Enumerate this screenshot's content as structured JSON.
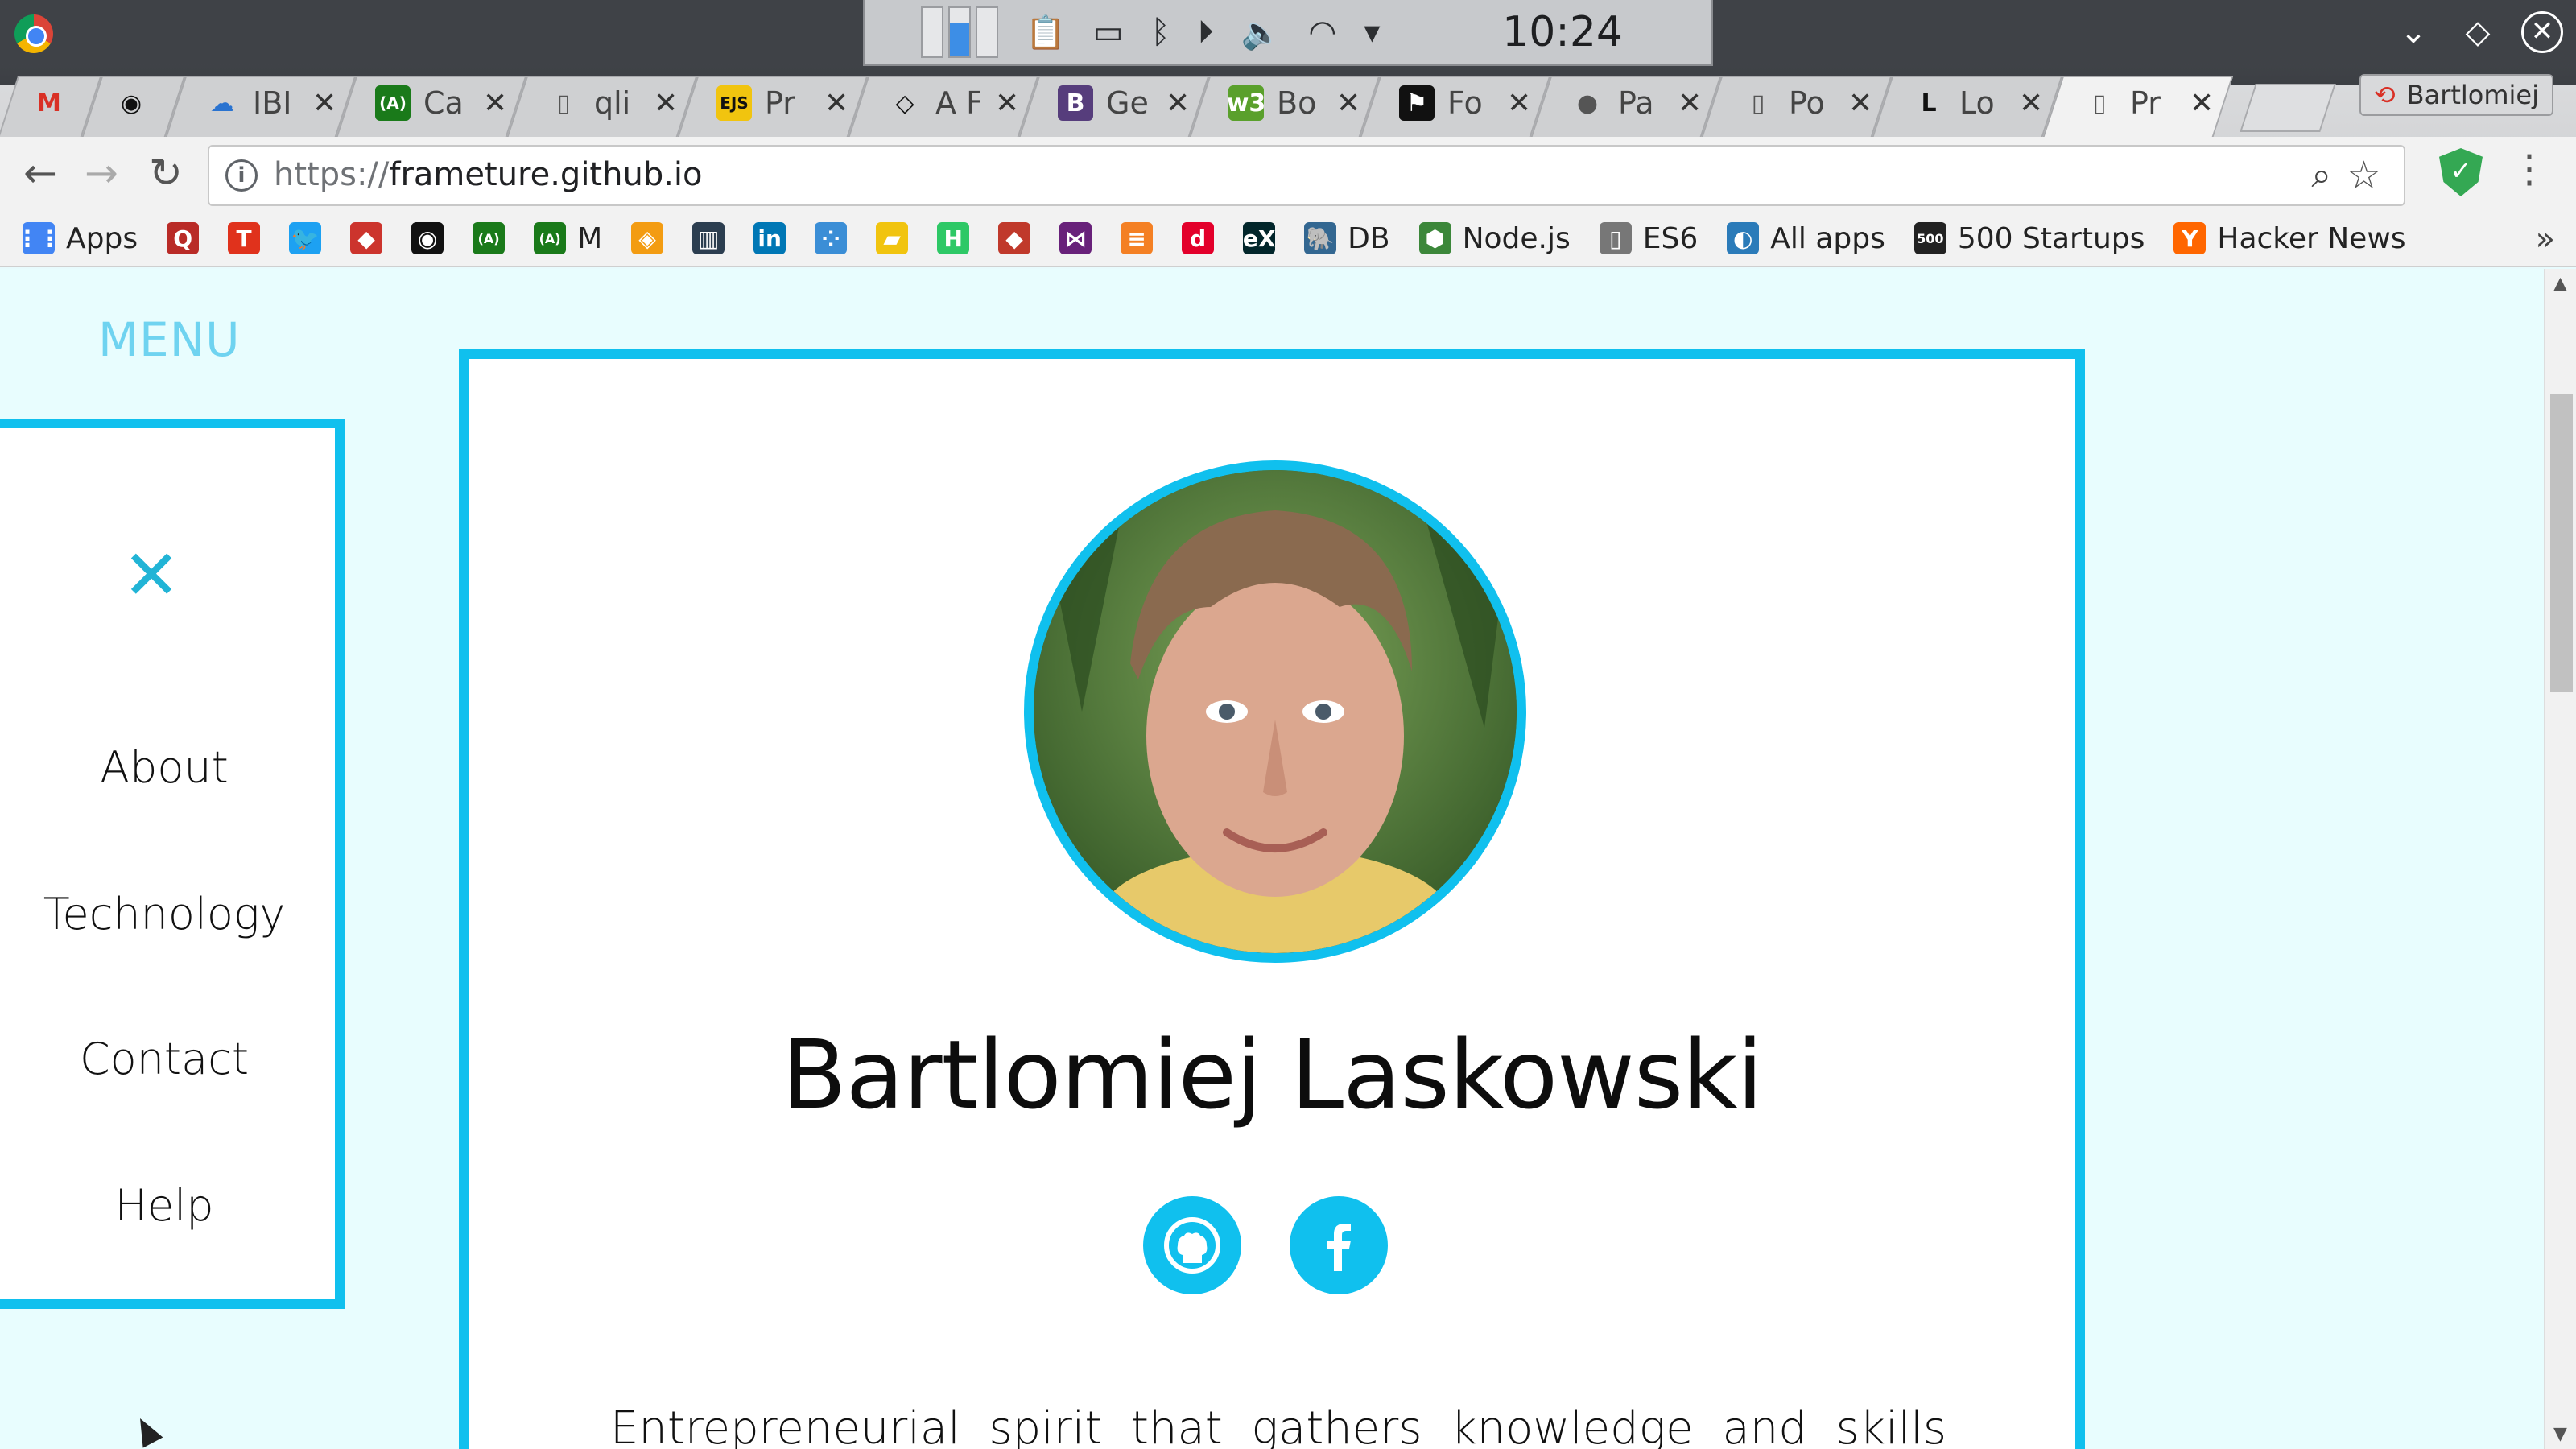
{
  "system_tray": {
    "clock": "10:24"
  },
  "tabs": [
    {
      "icon": "gmail-icon",
      "label": "",
      "fav": "M",
      "fav_color": "#d93025",
      "fav_bg": "transparent"
    },
    {
      "icon": "github-icon",
      "label": "",
      "fav": "◉",
      "fav_color": "#111",
      "fav_bg": "transparent"
    },
    {
      "icon": "ibm-cloud-icon",
      "label": "IBI",
      "fav": "☁",
      "fav_color": "#2a73d0",
      "fav_bg": "transparent"
    },
    {
      "icon": "freecodecamp-icon",
      "label": "Ca",
      "fav": "(A)",
      "fav_color": "#fff",
      "fav_bg": "#1a7a1a"
    },
    {
      "icon": "document-icon",
      "label": "qli",
      "fav": "▯",
      "fav_color": "#555",
      "fav_bg": "transparent"
    },
    {
      "icon": "ejs-icon",
      "label": "Pr",
      "fav": "EJS",
      "fav_color": "#111",
      "fav_bg": "#f1c40f"
    },
    {
      "icon": "codepen-icon",
      "label": "A F",
      "fav": "◇",
      "fav_color": "#111",
      "fav_bg": "transparent"
    },
    {
      "icon": "bootstrap-icon",
      "label": "Ge",
      "fav": "B",
      "fav_color": "#fff",
      "fav_bg": "#563d7c"
    },
    {
      "icon": "w3c-icon",
      "label": "Bo",
      "fav": "w3",
      "fav_color": "#fff",
      "fav_bg": "#5aa02c"
    },
    {
      "icon": "flag-icon",
      "label": "Fo",
      "fav": "⚑",
      "fav_color": "#fff",
      "fav_bg": "#111"
    },
    {
      "icon": "person-icon",
      "label": "Pa",
      "fav": "●",
      "fav_color": "#555",
      "fav_bg": "transparent"
    },
    {
      "icon": "document-icon",
      "label": "Po",
      "fav": "▯",
      "fav_color": "#555",
      "fav_bg": "transparent"
    },
    {
      "icon": "letter-l-icon",
      "label": "Lo",
      "fav": "L",
      "fav_color": "#111",
      "fav_bg": "transparent"
    },
    {
      "icon": "document-icon",
      "label": "Pr",
      "fav": "▯",
      "fav_color": "#555",
      "fav_bg": "transparent",
      "active": true
    }
  ],
  "profile": {
    "name": "Bartlomiej"
  },
  "toolbar": {
    "back": "←",
    "forward": "→",
    "reload": "↻",
    "url_scheme": "https://",
    "url_host": "frameture.github.io"
  },
  "bookmarks": [
    {
      "icon": "apps-icon",
      "label": "Apps",
      "glyph": "⋮⋮",
      "color": "#4285f4"
    },
    {
      "icon": "quora-icon",
      "label": "",
      "glyph": "Q",
      "color": "#b92b27"
    },
    {
      "icon": "t-icon",
      "label": "",
      "glyph": "T",
      "color": "#e0321c"
    },
    {
      "icon": "twitter-icon",
      "label": "",
      "glyph": "🐦",
      "color": "#1da1f2"
    },
    {
      "icon": "ruby-icon",
      "label": "",
      "glyph": "◆",
      "color": "#cc342d"
    },
    {
      "icon": "github-icon",
      "label": "",
      "glyph": "◉",
      "color": "#111"
    },
    {
      "icon": "freecodecamp-icon",
      "label": "",
      "glyph": "(A)",
      "color": "#1a7a1a"
    },
    {
      "icon": "freecodecamp-icon",
      "label": "M",
      "glyph": "(A)",
      "color": "#1a7a1a"
    },
    {
      "icon": "layers-icon",
      "label": "",
      "glyph": "◈",
      "color": "#f39c12"
    },
    {
      "icon": "bars-icon",
      "label": "",
      "glyph": "▥",
      "color": "#2c3e50"
    },
    {
      "icon": "linkedin-icon",
      "label": "",
      "glyph": "in",
      "color": "#0077b5"
    },
    {
      "icon": "dots-icon",
      "label": "",
      "glyph": "⁘",
      "color": "#3b8ed6"
    },
    {
      "icon": "folder-icon",
      "label": "",
      "glyph": "▰",
      "color": "#f1c40f"
    },
    {
      "icon": "hackerrank-icon",
      "label": "",
      "glyph": "H",
      "color": "#2ec866"
    },
    {
      "icon": "gem-icon",
      "label": "",
      "glyph": "◆",
      "color": "#c0392b"
    },
    {
      "icon": "visualstudio-icon",
      "label": "",
      "glyph": "⋈",
      "color": "#68217a"
    },
    {
      "icon": "stackoverflow-icon",
      "label": "",
      "glyph": "≡",
      "color": "#f48024"
    },
    {
      "icon": "diki-icon",
      "label": "",
      "glyph": "d",
      "color": "#e3002b"
    },
    {
      "icon": "edx-icon",
      "label": "",
      "glyph": "eX",
      "color": "#02262b"
    },
    {
      "icon": "postgres-icon",
      "label": "DB",
      "glyph": "🐘",
      "color": "#336791"
    },
    {
      "icon": "nodejs-icon",
      "label": "Node.js",
      "glyph": "⬢",
      "color": "#3c873a"
    },
    {
      "icon": "document-icon",
      "label": "ES6",
      "glyph": "▯",
      "color": "#777"
    },
    {
      "icon": "allapps-icon",
      "label": "All apps",
      "glyph": "◐",
      "color": "#2b7bb9"
    },
    {
      "icon": "500startups-icon",
      "label": "500 Startups",
      "glyph": "500",
      "color": "#222"
    },
    {
      "icon": "hackernews-icon",
      "label": "Hacker News",
      "glyph": "Y",
      "color": "#ff6600"
    }
  ],
  "bookmarks_overflow": "»",
  "page": {
    "menu_title": "MENU",
    "nav": [
      "About",
      "Technology",
      "Contact",
      "Help"
    ],
    "profile_name": "Bartlomiej Laskowski",
    "bio": "Entrepreneurial spirit that gathers knowledge and skills necessary to"
  },
  "colors": {
    "accent": "#10c0ee",
    "menu_title": "#6fd3f0",
    "page_bg": "#e8fdfe"
  }
}
